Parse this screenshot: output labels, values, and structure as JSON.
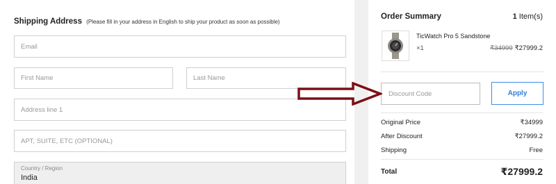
{
  "shipping": {
    "title": "Shipping Address",
    "note": "(Please fill in your address in English to ship your product as soon as possible)",
    "fields": {
      "email": "Email",
      "first_name": "First Name",
      "last_name": "Last Name",
      "address1": "Address line 1",
      "address2": "APT, SUITE, ETC (OPTIONAL)",
      "country_label": "Country / Region",
      "country_value": "India"
    }
  },
  "summary": {
    "title": "Order Summary",
    "count_number": "1",
    "count_label": "Item(s)",
    "product": {
      "name": "TicWatch Pro 5 Sandstone",
      "qty": "×1",
      "old_price": "₹34999",
      "price": "₹27999.2"
    },
    "discount_placeholder": "Discount Code",
    "apply_label": "Apply",
    "rows": [
      {
        "label": "Original Price",
        "value": "₹34999"
      },
      {
        "label": "After Discount",
        "value": "₹27999.2"
      },
      {
        "label": "Shipping",
        "value": "Free"
      }
    ],
    "total_label": "Total",
    "total_value": "₹27999.2"
  },
  "colors": {
    "accent": "#3a8ee6",
    "arrow": "#7a1016"
  },
  "icons": {
    "product_thumb": "watch-icon",
    "annotation": "arrow-right-icon"
  }
}
